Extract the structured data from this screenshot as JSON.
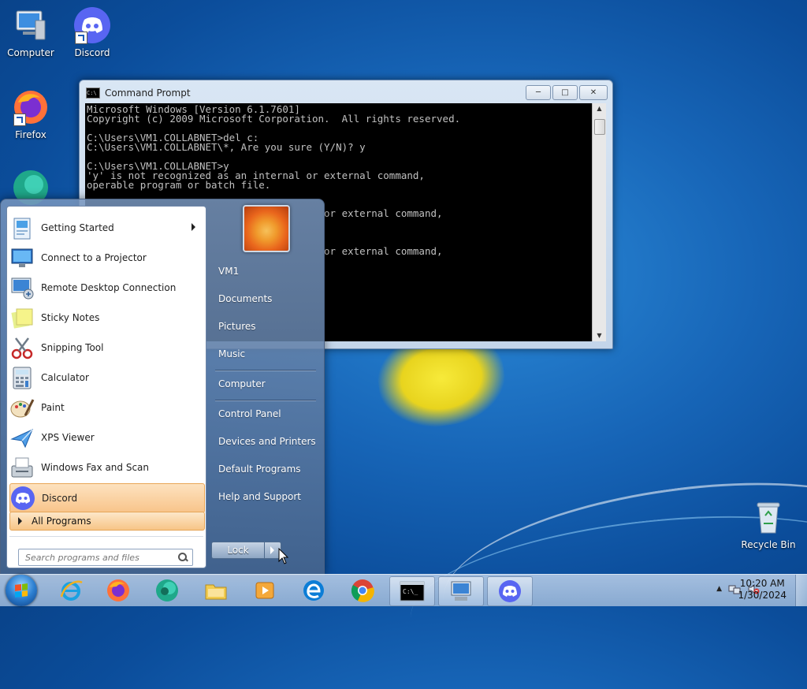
{
  "desktop": {
    "icons": [
      {
        "label": "Computer",
        "icon": "computer-icon"
      },
      {
        "label": "Discord",
        "icon": "discord-icon"
      },
      {
        "label": "Firefox",
        "icon": "firefox-icon"
      },
      {
        "label": "Recycle Bin",
        "icon": "recycle-bin-icon"
      }
    ]
  },
  "cmd": {
    "title": "Command Prompt",
    "lines": [
      "Microsoft Windows [Version 6.1.7601]",
      "Copyright (c) 2009 Microsoft Corporation.  All rights reserved.",
      "",
      "C:\\Users\\VM1.COLLABNET>del c:",
      "C:\\Users\\VM1.COLLABNET\\*, Are you sure (Y/N)? y",
      "",
      "C:\\Users\\VM1.COLLABNET>y",
      "'y' is not recognized as an internal or external command,",
      "operable program or batch file.",
      "",
      "",
      "                                        or external command,",
      "",
      "",
      "",
      "                                        or external command,"
    ]
  },
  "start_menu": {
    "programs": [
      {
        "label": "Getting Started",
        "icon": "getting-started-icon",
        "submenu": true
      },
      {
        "label": "Connect to a Projector",
        "icon": "projector-icon"
      },
      {
        "label": "Remote Desktop Connection",
        "icon": "remote-desktop-icon"
      },
      {
        "label": "Sticky Notes",
        "icon": "sticky-notes-icon"
      },
      {
        "label": "Snipping Tool",
        "icon": "scissors-icon"
      },
      {
        "label": "Calculator",
        "icon": "calculator-icon"
      },
      {
        "label": "Paint",
        "icon": "paint-icon"
      },
      {
        "label": "XPS Viewer",
        "icon": "xps-viewer-icon"
      },
      {
        "label": "Windows Fax and Scan",
        "icon": "fax-icon"
      },
      {
        "label": "Discord",
        "icon": "discord-icon",
        "highlighted": true
      }
    ],
    "all_programs": "All Programs",
    "search_placeholder": "Search programs and files",
    "right_links": [
      "VM1",
      "Documents",
      "Pictures",
      "Music",
      "Computer",
      "Control Panel",
      "Devices and Printers",
      "Default Programs",
      "Help and Support"
    ],
    "lock_label": "Lock"
  },
  "taskbar": {
    "pinned": [
      {
        "name": "Internet Explorer",
        "icon": "internet-explorer-icon"
      },
      {
        "name": "Firefox",
        "icon": "firefox-icon"
      },
      {
        "name": "Edge (legacy sphere)",
        "icon": "sphere-icon"
      },
      {
        "name": "Windows Explorer",
        "icon": "folder-icon"
      },
      {
        "name": "Media Player",
        "icon": "media-player-icon"
      },
      {
        "name": "Edge",
        "icon": "edge-icon"
      },
      {
        "name": "Chrome",
        "icon": "chrome-icon"
      },
      {
        "name": "Command Prompt",
        "icon": "cmd-icon"
      },
      {
        "name": "Remote Desktop",
        "icon": "remote-desktop-icon"
      },
      {
        "name": "Discord",
        "icon": "discord-icon"
      }
    ],
    "time": "10:20 AM",
    "date": "1/30/2024"
  }
}
